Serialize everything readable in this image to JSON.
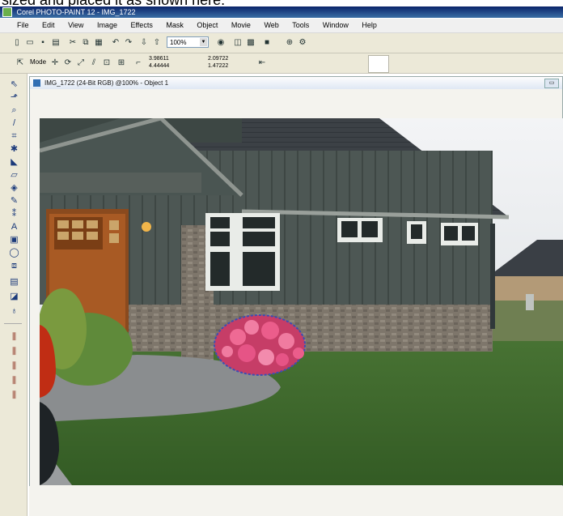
{
  "caption": {
    "text": "sized and placed it as shown here."
  },
  "window": {
    "title": "Corel PHOTO-PAINT 12 - IMG_1722"
  },
  "menu": [
    "File",
    "Edit",
    "View",
    "Image",
    "Effects",
    "Mask",
    "Object",
    "Movie",
    "Web",
    "Tools",
    "Window",
    "Help"
  ],
  "toolbar": {
    "zoom": "100%",
    "mode_label": "Mode"
  },
  "property_bar": {
    "x": "3.98611",
    "y": "4.44444",
    "w": "2.09722",
    "h": "1.47222"
  },
  "document": {
    "title": "IMG_1722 (24-Bit RGB) @100% - Object 1"
  },
  "colors": {
    "titlebar": "#0a246a",
    "chrome": "#ece9d8",
    "siding": "#4a5552",
    "roof": "#3a3f44",
    "lawn": "#3d6a2c",
    "flowers": "#e64d7c"
  },
  "icons": [
    "pick-tool-icon",
    "shape-tool-icon",
    "zoom-tool-icon",
    "eyedropper-icon",
    "crop-icon",
    "brush-icon",
    "fill-icon",
    "eraser-icon",
    "clone-icon",
    "text-icon",
    "rectangle-icon",
    "ellipse-icon",
    "object-icon",
    "color-swatch-icon"
  ]
}
